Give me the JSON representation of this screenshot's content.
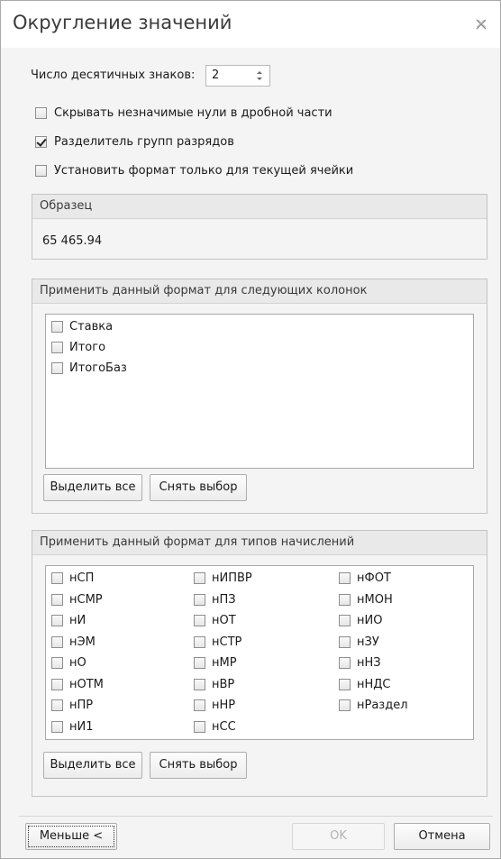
{
  "dialog": {
    "title": "Округление значений",
    "close_icon": "close-icon"
  },
  "decimals": {
    "label": "Число десятичных знаков:",
    "value": "2"
  },
  "options": [
    {
      "label": "Скрывать незначимые нули в дробной части",
      "checked": false
    },
    {
      "label": "Разделитель групп разрядов",
      "checked": true
    },
    {
      "label": "Установить формат только для текущей ячейки",
      "checked": false
    }
  ],
  "sample": {
    "title": "Образец",
    "value": "65 465.94"
  },
  "columns_group": {
    "title": "Применить данный формат для следующих колонок",
    "items": [
      {
        "label": "Ставка",
        "checked": false
      },
      {
        "label": "Итого",
        "checked": false
      },
      {
        "label": "ИтогоБаз",
        "checked": false
      }
    ],
    "select_all": "Выделить все",
    "clear": "Снять выбор"
  },
  "types_group": {
    "title": "Применить данный формат для типов начислений",
    "columns": [
      [
        "нСП",
        "нСМР",
        "нИ",
        "нЭМ",
        "нО",
        "нОТМ",
        "нПР",
        "нИ1"
      ],
      [
        "нИПВР",
        "нПЗ",
        "нОТ",
        "нСТР",
        "нМР",
        "нВР",
        "нНР",
        "нСС"
      ],
      [
        "нФОТ",
        "нМОН",
        "нИО",
        "нЗУ",
        "нНЗ",
        "нНДС",
        "нРаздел"
      ]
    ],
    "select_all": "Выделить все",
    "clear": "Снять выбор"
  },
  "footer": {
    "less": "Меньше <",
    "ok": "OK",
    "cancel": "Отмена"
  }
}
